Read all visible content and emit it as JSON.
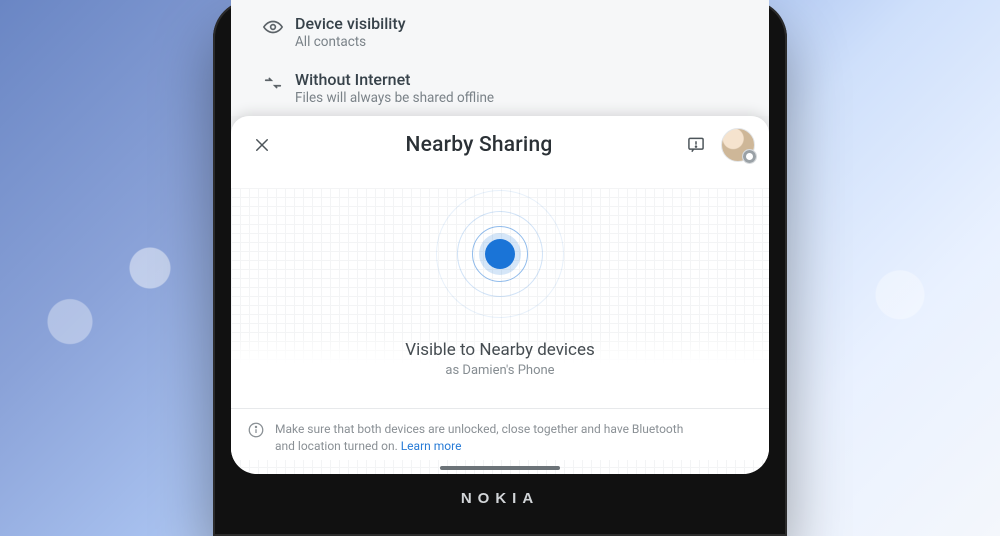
{
  "brand": "NOKIA",
  "settings": {
    "rows": [
      {
        "icon": "eye-icon",
        "title": "Device visibility",
        "subtitle": "All contacts"
      },
      {
        "icon": "offline-icon",
        "title": "Without Internet",
        "subtitle": "Files will always be shared offline"
      }
    ]
  },
  "sheet": {
    "title": "Nearby Sharing",
    "visibility_line1": "Visible to Nearby devices",
    "visibility_line2": "as Damien's Phone",
    "hint_text": "Make sure that both devices are unlocked, close together and have Bluetooth and location turned on. ",
    "learn_more": "Learn more"
  }
}
